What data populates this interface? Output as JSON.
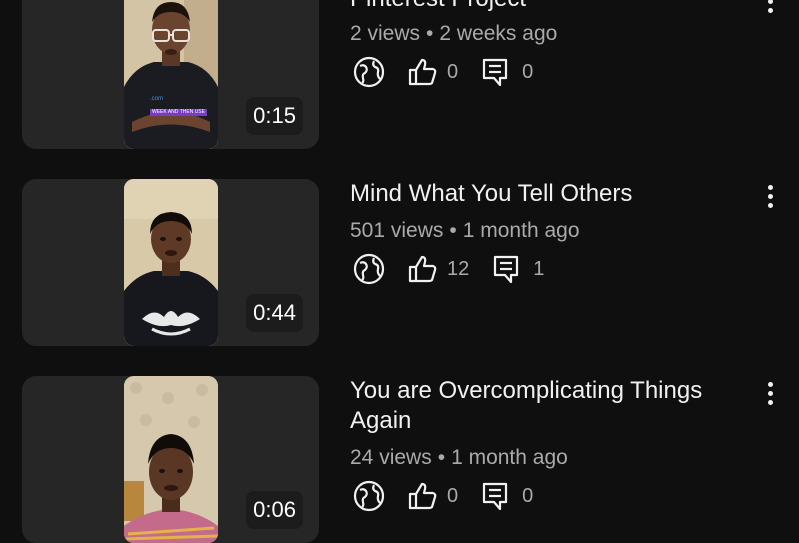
{
  "videos": [
    {
      "title": "Pinterest Project",
      "views": "2 views",
      "age": "2 weeks ago",
      "likes": "0",
      "comments": "0",
      "duration": "0:15",
      "caption_badge": "WEEK AND THEN USE"
    },
    {
      "title": "Mind What You Tell Others",
      "views": "501 views",
      "age": "1 month ago",
      "likes": "12",
      "comments": "1",
      "duration": "0:44"
    },
    {
      "title": "You are Overcomplicating Things Again",
      "views": "24 views",
      "age": "1 month ago",
      "likes": "0",
      "comments": "0",
      "duration": "0:06"
    }
  ],
  "meta_separator": "•",
  "icons": {
    "visibility": "globe-icon",
    "likes": "thumbs-up-icon",
    "comments": "comment-icon",
    "menu": "more-vert-icon"
  },
  "colors": {
    "background": "#0f0f0f",
    "text_primary": "#f1f1f1",
    "text_secondary": "#aaaaaa",
    "thumbnail_bg": "#262626"
  }
}
